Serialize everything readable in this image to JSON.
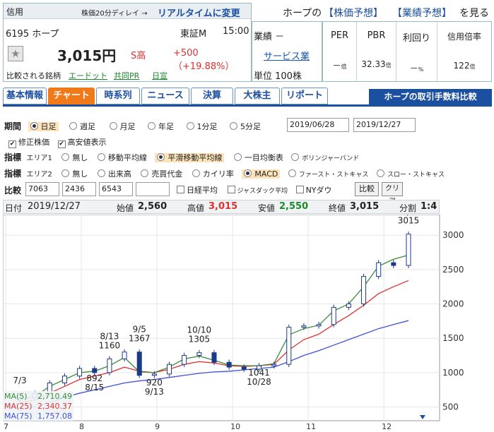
{
  "header": {
    "category": "信用",
    "delay_note": "株価20分ディレイ →",
    "realtime_link": "リアルタイムに変更",
    "forecast_prefix": "ホープの",
    "stock_forecast": "【株価予想】",
    "earnings_forecast": "【業績予想】",
    "forecast_suffix": "を見る",
    "code_name": "6195 ホープ",
    "market": "東証M",
    "time": "15:00",
    "price": "3,015円",
    "stop_high": "S高",
    "change": "+500（+19.88%）",
    "industry_label": "業績 －",
    "industry_link": "サービス業",
    "unit": "単位 100株",
    "compare_label": "比較される銘柄",
    "compare_links": [
      "エードット",
      "共同PR",
      "日宣"
    ]
  },
  "stats": [
    {
      "label": "PER",
      "value": "－",
      "unit": "倍"
    },
    {
      "label": "PBR",
      "value": "32.33",
      "unit": "倍"
    },
    {
      "label": "利回り",
      "value": "－",
      "unit": "%"
    },
    {
      "label": "信用倍率",
      "value": "122",
      "unit": "倍"
    }
  ],
  "tabs": [
    "基本情報",
    "チャート",
    "時系列",
    "ニュース",
    "決算",
    "大株主",
    "リポート"
  ],
  "fee_button": "ホープの取引手数料比較",
  "period": {
    "label": "期間",
    "options": [
      "日足",
      "週足",
      "月足",
      "年足",
      "1分足",
      "5分足"
    ],
    "selected": "日足",
    "from": "2019/06/28",
    "to": "2019/12/27"
  },
  "checks": {
    "adjusted": "修正株価",
    "high_low": "高安値表示"
  },
  "indicator1": {
    "label": "指標",
    "area": "エリア1",
    "options": [
      "無し",
      "移動平均線",
      "平滑移動平均線",
      "一目均衡表",
      "ボリンジャーバンド"
    ],
    "selected": "平滑移動平均線"
  },
  "indicator2": {
    "label": "指標",
    "area": "エリア2",
    "options": [
      "無し",
      "出来高",
      "売買代金",
      "カイリ率",
      "MACD",
      "ファースト・ストキャス",
      "スロー・ストキャス"
    ],
    "selected": "MACD"
  },
  "compare": {
    "label": "比較",
    "codes": [
      "7063",
      "2436",
      "6543",
      ""
    ],
    "nikkei": "日経平均",
    "jasdaq": "ジャスダック平均",
    "nydow": "NYダウ",
    "compare_btn": "比較",
    "clear_btn": "クリア"
  },
  "ohlc": {
    "date_label": "日付",
    "date": "2019/12/27",
    "open_label": "始値",
    "open": "2,560",
    "high_label": "高値",
    "high": "3,015",
    "low_label": "安値",
    "low": "2,550",
    "close_label": "終値",
    "close": "3,015",
    "split_label": "分割",
    "split": "1:4"
  },
  "colors": {
    "up": "#1a9a2a",
    "down": "#e03030",
    "accent": "#f07a1a",
    "ma5": "#3c8a3c",
    "ma25": "#e03030",
    "ma75": "#4050d8"
  },
  "chart_data": {
    "type": "candlestick",
    "ylim": [
      300,
      3300
    ],
    "y_ticks": [
      3000,
      2500,
      2000,
      1500,
      1000,
      500
    ],
    "x_ticks": [
      "7",
      "8",
      "9",
      "10",
      "11",
      "12"
    ],
    "legend": [
      {
        "name": "MA(5)",
        "value": "2,710.49"
      },
      {
        "name": "MA(25)",
        "value": "2,340.37"
      },
      {
        "name": "MA(75)",
        "value": "1,757.08"
      }
    ],
    "annotations": [
      {
        "date": "7/3",
        "value": ""
      },
      {
        "date": "8/13",
        "value": "1160"
      },
      {
        "date": "8/15",
        "value": "892"
      },
      {
        "date": "9/5",
        "value": "1367"
      },
      {
        "date": "9/13",
        "value": "920"
      },
      {
        "date": "10/10",
        "value": "1305"
      },
      {
        "date": "10/28",
        "value": "1041"
      },
      {
        "date": "12/27",
        "value": "3015"
      }
    ],
    "ma5": [
      600,
      650,
      800,
      900,
      1000,
      1020,
      1100,
      1220,
      1010,
      1000,
      1080,
      1200,
      1240,
      1180,
      1110,
      1100,
      1100,
      1130,
      1550,
      1640,
      1690,
      1900,
      2000,
      2250,
      2550,
      2650,
      2710
    ],
    "ma25": [
      560,
      600,
      700,
      800,
      900,
      950,
      1000,
      1080,
      1020,
      1000,
      1050,
      1120,
      1160,
      1140,
      1100,
      1090,
      1100,
      1120,
      1330,
      1480,
      1560,
      1700,
      1830,
      1980,
      2150,
      2250,
      2340
    ],
    "ma75": [
      450,
      500,
      560,
      640,
      700,
      750,
      800,
      850,
      880,
      900,
      930,
      960,
      990,
      1010,
      1020,
      1040,
      1060,
      1080,
      1160,
      1250,
      1320,
      1400,
      1480,
      1560,
      1640,
      1700,
      1757
    ],
    "close": [
      640,
      700,
      850,
      950,
      1060,
      1000,
      1200,
      1300,
      960,
      980,
      1120,
      1250,
      1290,
      1150,
      1080,
      1050,
      1100,
      1120,
      1660,
      1680,
      1700,
      1950,
      2000,
      2400,
      2600,
      2560,
      3015
    ]
  }
}
